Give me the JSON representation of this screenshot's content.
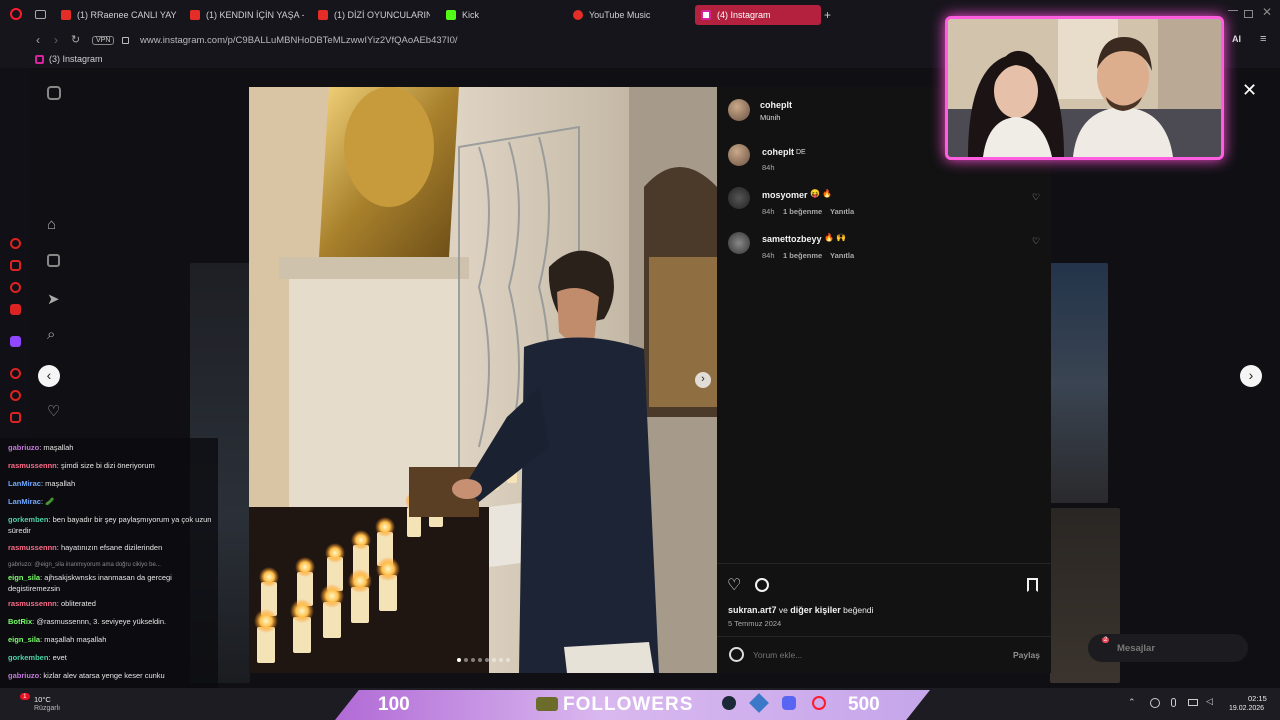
{
  "browser": {
    "tabs": [
      {
        "label": "(1) RRaenee CANLI YAYINI",
        "color": "#e52d27"
      },
      {
        "label": "(1) KENDIN İÇİN YAŞA - Y",
        "color": "#e52d27"
      },
      {
        "label": "(1) DİZİ OYUNCULARININ",
        "color": "#e52d27"
      },
      {
        "label": "Kick",
        "color": "#53fc18"
      },
      {
        "label": "YouTube Music",
        "color": "#e52d27"
      },
      {
        "label": "(4) Instagram",
        "color": "#d6249f"
      }
    ],
    "url": "www.instagram.com/p/C9BALLuMBNHoDBTeMLzwwIYiz2VfQAoAEb437I0/",
    "vpn_label": "VPN",
    "bookmark": "(3) Instagram",
    "ai_label": "AI"
  },
  "post": {
    "author": "cohepIt",
    "location": "Münih",
    "caption_author": "cohepIt",
    "caption_text": "DE",
    "caption_time": "84h",
    "comments": [
      {
        "user": "mosyomer",
        "text": "😝 🔥",
        "time": "84h",
        "likes": "1 beğenme",
        "reply": "Yanıtla"
      },
      {
        "user": "samettozbeyy",
        "text": "🔥 🙌",
        "time": "84h",
        "likes": "1 beğenme",
        "reply": "Yanıtla"
      }
    ],
    "liked_by_user": "sukran.art7",
    "liked_by_joiner": "ve",
    "liked_by_others": "diğer kişiler",
    "liked_by_suffix": "beğendi",
    "date": "5 Temmuz 2024",
    "comment_placeholder": "Yorum ekle...",
    "share_label": "Paylaş",
    "carousel_dots": 8,
    "carousel_active": 1
  },
  "instagram_bg": {
    "messages_label": "Mesajlar",
    "notif_count": "2"
  },
  "chat": [
    {
      "user": "gabriuzo",
      "color": "#c678dd",
      "text": "maşallah"
    },
    {
      "user": "rasmussennn",
      "color": "#ff6b8a",
      "text": "şimdi size bi dizi öneriyorum"
    },
    {
      "user": "LanMirac",
      "color": "#6fa8ff",
      "text": "maşallah"
    },
    {
      "user": "LanMirac",
      "color": "#6fa8ff",
      "text": "🥒"
    },
    {
      "user": "gorkemben",
      "color": "#4fd1a5",
      "text": "ben bayadır bir şey paylaşmıyorum ya çok uzun süredir"
    },
    {
      "user": "rasmussennn",
      "color": "#ff6b8a",
      "text": "hayatınızın efsane dizilerinden"
    },
    {
      "user": "",
      "color": "#888888",
      "text": "gabriuzo: @eign_sila inanmıyorum ama doğru cikiyo be..."
    },
    {
      "user": "eign_sila",
      "color": "#7bff6b",
      "text": "ajhsakjskwnsks inanmasan da gercegi degistiremezsin"
    },
    {
      "user": "rasmussennn",
      "color": "#ff6b8a",
      "text": "obliterated"
    },
    {
      "user": "BotRix",
      "color": "#7bff6b",
      "text": "@rasmussennn, 3. seviyeye yükseldin."
    },
    {
      "user": "eign_sila",
      "color": "#7bff6b",
      "text": "maşallah maşallah"
    },
    {
      "user": "gorkemben",
      "color": "#4fd1a5",
      "text": "evet"
    },
    {
      "user": "gabriuzo",
      "color": "#c678dd",
      "text": "kizlar alev atarsa yenge keser cunku"
    }
  ],
  "taskbar": {
    "weather_temp": "10°C",
    "weather_desc": "Rüzgarlı",
    "weather_badge": "1",
    "goal_current": "100",
    "goal_label": "FOLLOWERS",
    "goal_target": "500",
    "time": "02:15",
    "date": "19.02.2026"
  }
}
